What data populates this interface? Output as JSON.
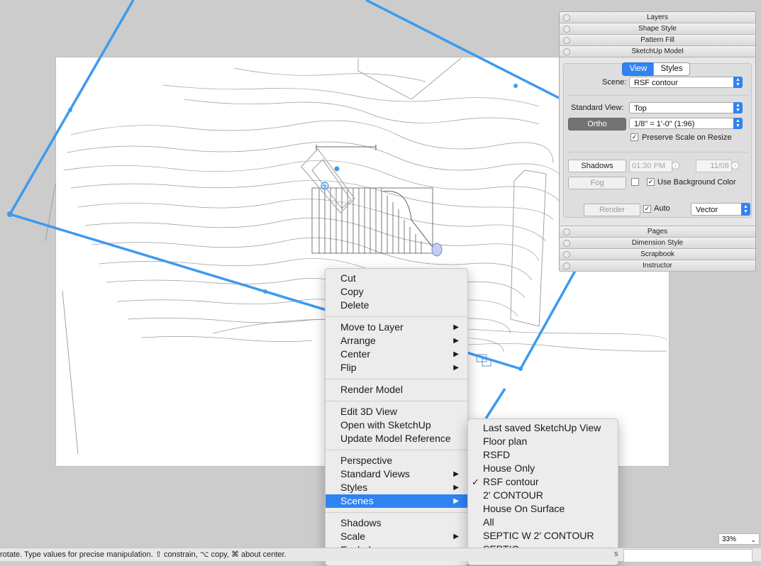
{
  "context_menu": {
    "groups": [
      [
        {
          "label": "Cut"
        },
        {
          "label": "Copy"
        },
        {
          "label": "Delete"
        }
      ],
      [
        {
          "label": "Move to Layer",
          "submenu": true
        },
        {
          "label": "Arrange",
          "submenu": true
        },
        {
          "label": "Center",
          "submenu": true
        },
        {
          "label": "Flip",
          "submenu": true
        }
      ],
      [
        {
          "label": "Render Model"
        }
      ],
      [
        {
          "label": "Edit 3D View"
        },
        {
          "label": "Open with SketchUp"
        },
        {
          "label": "Update Model Reference"
        }
      ],
      [
        {
          "label": "Perspective"
        },
        {
          "label": "Standard Views",
          "submenu": true
        },
        {
          "label": "Styles",
          "submenu": true
        },
        {
          "label": "Scenes",
          "submenu": true,
          "active": true
        }
      ],
      [
        {
          "label": "Shadows"
        },
        {
          "label": "Scale",
          "submenu": true
        },
        {
          "label": "Explode"
        }
      ]
    ]
  },
  "scenes_submenu": {
    "items": [
      {
        "label": "Last saved SketchUp View"
      },
      {
        "label": "Floor plan"
      },
      {
        "label": "RSFD"
      },
      {
        "label": "House Only"
      },
      {
        "label": "RSF contour",
        "checked": true
      },
      {
        "label": "2' CONTOUR"
      },
      {
        "label": "House On Surface"
      },
      {
        "label": "All"
      },
      {
        "label": "SEPTIC W 2' CONTOUR"
      },
      {
        "label": "SEPTIC"
      }
    ]
  },
  "inspector": {
    "top_panes": [
      "Layers",
      "Shape Style",
      "Pattern Fill",
      "SketchUp Model"
    ],
    "bottom_panes": [
      "Pages",
      "Dimension Style",
      "Scrapbook",
      "Instructor"
    ],
    "tabs": {
      "view": "View",
      "styles": "Styles"
    },
    "scene_label": "Scene:",
    "scene_value": "RSF contour",
    "standard_view_label": "Standard View:",
    "standard_view_value": "Top",
    "ortho_label": "Ortho",
    "scale_value": "1/8\" = 1'-0\" (1:96)",
    "preserve_scale_label": "Preserve Scale on Resize",
    "preserve_scale_checked": "✓",
    "shadows_label": "Shadows",
    "time_value": "01:30 PM",
    "date_value": "11/08",
    "fog_label": "Fog",
    "use_bg_label": "Use Background Color",
    "use_bg_checked": "✓",
    "render_label": "Render",
    "auto_label": "Auto",
    "auto_checked": "✓",
    "render_mode": "Vector"
  },
  "status_bar": {
    "text": "rotate. Type values for precise manipulation. ⇧ constrain, ⌥ copy, ⌘ about center.",
    "measure_label": "s"
  },
  "zoom": {
    "value": "33%"
  },
  "colors": {
    "selection": "#3d9aee",
    "menu_highlight": "#2f83f3"
  }
}
